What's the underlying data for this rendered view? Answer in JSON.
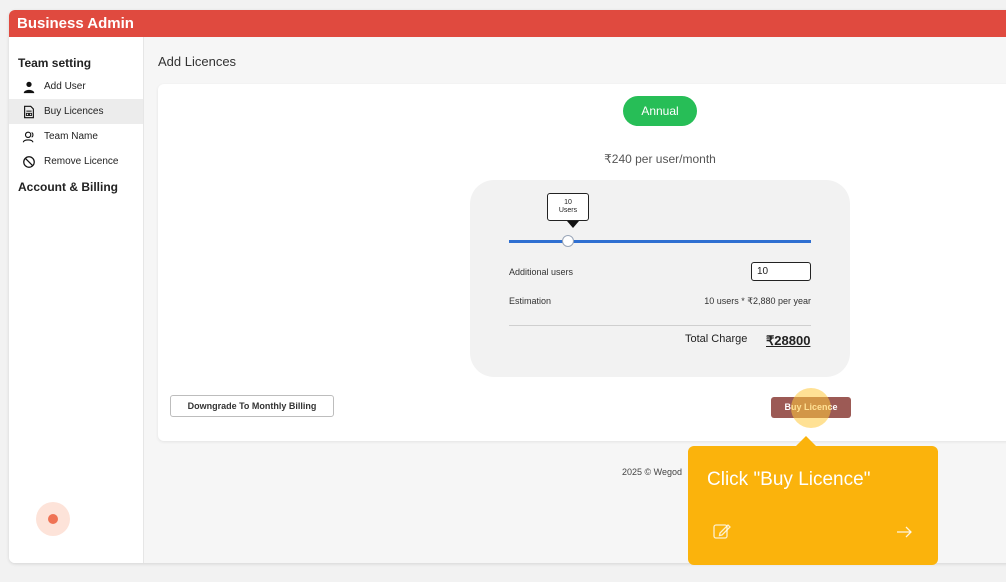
{
  "app": {
    "title": "Business Admin"
  },
  "sidebar": {
    "sections": [
      {
        "heading": "Team setting"
      },
      {
        "heading": "Account & Billing"
      }
    ],
    "items": [
      {
        "label": "Add User",
        "icon": "person-icon",
        "active": false
      },
      {
        "label": "Buy Licences",
        "icon": "document-icon",
        "active": true
      },
      {
        "label": "Team Name",
        "icon": "team-icon",
        "active": false
      },
      {
        "label": "Remove Licence",
        "icon": "block-icon",
        "active": false
      }
    ]
  },
  "main": {
    "title": "Add Licences",
    "plan": "Annual",
    "price": "₹240 per user/month",
    "slider": {
      "tooltip_value": "10",
      "tooltip_unit": "Users",
      "value": 10
    },
    "additional_users_label": "Additional users",
    "additional_users_value": "10",
    "estimation_label": "Estimation",
    "estimation_value": "10 users * ₹2,880 per year",
    "total_label": "Total Charge",
    "total_value": "₹28800",
    "downgrade_label": "Downgrade To Monthly Billing",
    "buy_label": "Buy Licence",
    "footer": "2025 © Wegod"
  },
  "guide": {
    "text": "Click \"Buy Licence\"",
    "icons": [
      "edit-icon",
      "arrow-right-icon"
    ]
  },
  "colors": {
    "topbar": "#e04a3f",
    "plan_pill": "#27be57",
    "slider": "#2f6fd1",
    "buy_button": "#9c5a55",
    "guide": "#fbb30c"
  }
}
